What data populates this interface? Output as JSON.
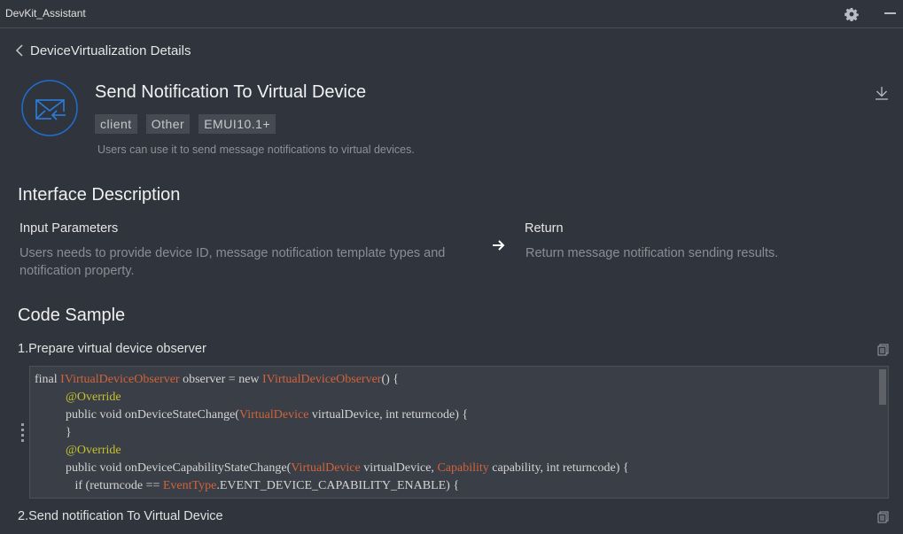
{
  "window": {
    "title": "DevKit_Assistant",
    "icons": [
      "gear-icon",
      "minimize-icon"
    ]
  },
  "nav": {
    "back_label": "DeviceVirtualization Details"
  },
  "feature": {
    "icon": "mail-receive-icon",
    "title": "Send Notification To Virtual Device",
    "tags": [
      "client",
      "Other",
      "EMUI10.1+"
    ],
    "description": "Users can use it to send message notifications to virtual devices.",
    "download_icon": "download-icon"
  },
  "interface": {
    "title": "Interface Description",
    "input_title": "Input Parameters",
    "input_text_line1": "Users needs to provide device ID, message notification template types and",
    "input_text_line2": "notification property.",
    "return_title": "Return",
    "return_text": "Return message notification sending results."
  },
  "code_sample": {
    "title": "Code Sample",
    "steps": [
      {
        "label": "1.Prepare virtual device observer",
        "lines": [
          [
            {
              "t": "final "
            },
            {
              "t": "IVirtualDeviceObserver",
              "c": "type"
            },
            {
              "t": " observer = new "
            },
            {
              "t": "IVirtualDeviceObserver",
              "c": "type"
            },
            {
              "t": "() {"
            }
          ],
          [
            {
              "t": "          "
            },
            {
              "t": "@Override",
              "c": "anno"
            }
          ],
          [
            {
              "t": "          public void onDeviceStateChange("
            },
            {
              "t": "VirtualDevice",
              "c": "type"
            },
            {
              "t": " virtualDevice, int returncode) {"
            }
          ],
          [
            {
              "t": "          }"
            }
          ],
          [
            {
              "t": "          "
            },
            {
              "t": "@Override",
              "c": "anno"
            }
          ],
          [
            {
              "t": "          public void onDeviceCapabilityStateChange("
            },
            {
              "t": "VirtualDevice",
              "c": "type"
            },
            {
              "t": " virtualDevice, "
            },
            {
              "t": "Capability",
              "c": "type"
            },
            {
              "t": " capability, int returncode) {"
            }
          ],
          [
            {
              "t": "             if (returncode == "
            },
            {
              "t": "EventType",
              "c": "type"
            },
            {
              "t": ".EVENT_DEVICE_CAPABILITY_ENABLE) {"
            }
          ]
        ]
      },
      {
        "label": "2.Send notification To Virtual Device"
      }
    ]
  },
  "colors": {
    "background": "#30343c",
    "accent_blue": "#1f6fd0",
    "code_type": "#d0643c",
    "code_annotation": "#c5c230"
  }
}
